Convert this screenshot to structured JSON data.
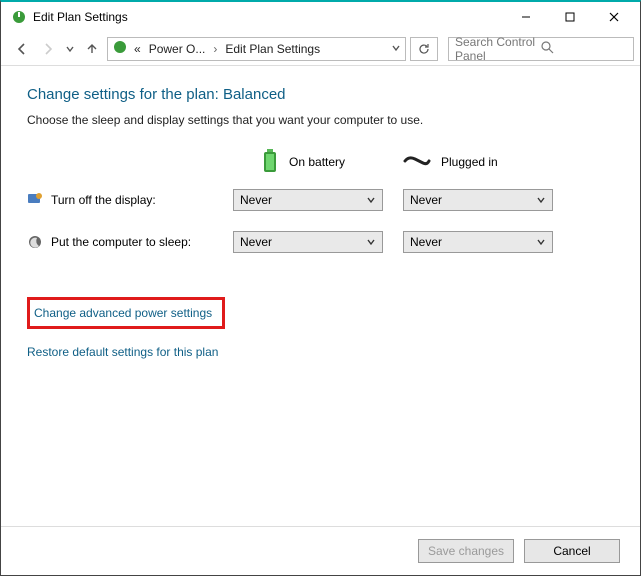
{
  "window": {
    "title": "Edit Plan Settings"
  },
  "breadcrumb": {
    "root": "«",
    "part1": "Power O...",
    "part2": "Edit Plan Settings"
  },
  "search": {
    "placeholder": "Search Control Panel"
  },
  "page": {
    "heading": "Change settings for the plan: Balanced",
    "subtext": "Choose the sleep and display settings that you want your computer to use."
  },
  "columns": {
    "battery": "On battery",
    "plugged": "Plugged in"
  },
  "rows": {
    "display": {
      "label": "Turn off the display:",
      "battery_value": "Never",
      "plugged_value": "Never"
    },
    "sleep": {
      "label": "Put the computer to sleep:",
      "battery_value": "Never",
      "plugged_value": "Never"
    }
  },
  "links": {
    "advanced": "Change advanced power settings",
    "restore": "Restore default settings for this plan"
  },
  "buttons": {
    "save": "Save changes",
    "cancel": "Cancel"
  }
}
